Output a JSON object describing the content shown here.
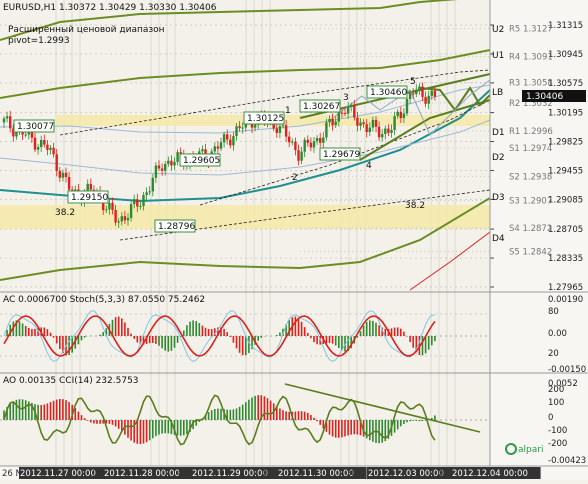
{
  "window": {
    "symbol_header": "EURUSD,H1  1.30372 1.30429 1.30330 1.30406",
    "indicator_line1": "Расширенный ценовой диапазон",
    "indicator_line2": "pivot=1.2993"
  },
  "main_chart": {
    "current_price_label": "1.30406",
    "y_ticks": [
      "1.31315",
      "1.30945",
      "1.30575",
      "1.30195",
      "1.29825",
      "1.29455",
      "1.29085",
      "1.28705",
      "1.28335",
      "1.27965"
    ],
    "pivot_labels": [
      "U2",
      "U1",
      "LB",
      "D1",
      "D2",
      "D3",
      "D4"
    ],
    "level_labels": [
      "R5 1.3127",
      "R4 1.3091",
      "R3 1.3058",
      "R2 1.3032",
      "R1 1.2996",
      "S1 1.2974",
      "S2 1.2938",
      "S3 1.2907",
      "S4 1.2872",
      "S5 1.2842"
    ],
    "price_tags": [
      "1.30077",
      "1.30125",
      "1.30267",
      "1.30460",
      "1.29605",
      "1.29679",
      "1.29150",
      "1.28796"
    ],
    "wave_labels": [
      "1",
      "2",
      "3",
      "4",
      "5"
    ],
    "fib_labels": [
      "38.2",
      "38.2"
    ],
    "colors": {
      "bull_candle": "#2f8a2f",
      "bear_candle": "#e0211b",
      "band": "#6b8e23",
      "midline": "#1f8f8f",
      "support_zone": "#f5e9a8",
      "label_border": "#3b8f3b"
    }
  },
  "ac_panel": {
    "header": "AC 0.0006700  Stoch(5,3,3) 87.0550 75.2462",
    "y_ticks": [
      "0.00190",
      "80",
      "0.00",
      "20",
      "-0.00150"
    ]
  },
  "ao_panel": {
    "header": "AO 0.00135  CCI(14) 232.5753",
    "y_ticks": [
      "0.0052",
      "200",
      "100",
      "0",
      "-100",
      "-200",
      "-0.00423"
    ],
    "watermark": "alpari"
  },
  "time_axis": {
    "labels": [
      "26 N",
      "2012.11.27 00:00",
      "02:",
      "2012.11.28 00:00",
      "8 N",
      "2012.11.29 00:00",
      "02:",
      "2012.11.30 00:00",
      "30 N",
      "2012.12.03 00:00",
      "02:",
      "2012.12.04 00:00"
    ]
  },
  "chart_data": {
    "type": "candlestick",
    "symbol": "EURUSD",
    "timeframe": "H1",
    "ylim": [
      1.27965,
      1.31315
    ],
    "x": [
      "2012.11.27",
      "2012.11.28",
      "2012.11.29",
      "2012.11.30",
      "2012.12.03",
      "2012.12.04"
    ],
    "close_path": [
      1.3007,
      1.299,
      1.2972,
      1.2915,
      1.292,
      1.288,
      1.2905,
      1.2955,
      1.296,
      1.2965,
      1.299,
      1.3012,
      1.3005,
      1.2968,
      1.299,
      1.3026,
      1.3,
      1.2995,
      1.3046,
      1.304
    ],
    "marked_prices": [
      1.30077,
      1.30125,
      1.30267,
      1.3046,
      1.29605,
      1.29679,
      1.2915,
      1.28796
    ],
    "levels": {
      "R5": 1.3127,
      "R4": 1.3091,
      "R3": 1.3058,
      "R2": 1.3032,
      "R1": 1.2996,
      "S1": 1.2974,
      "S2": 1.2938,
      "S3": 1.2907,
      "S4": 1.2872,
      "S5": 1.2842,
      "pivot": 1.2993
    },
    "ohlc_last": {
      "open": 1.30372,
      "high": 1.30429,
      "low": 1.3033,
      "close": 1.30406
    },
    "indicators": {
      "AC": 0.00067,
      "Stoch_main": 87.055,
      "Stoch_signal": 75.2462,
      "AO": 0.00135,
      "CCI14": 232.5753
    }
  }
}
